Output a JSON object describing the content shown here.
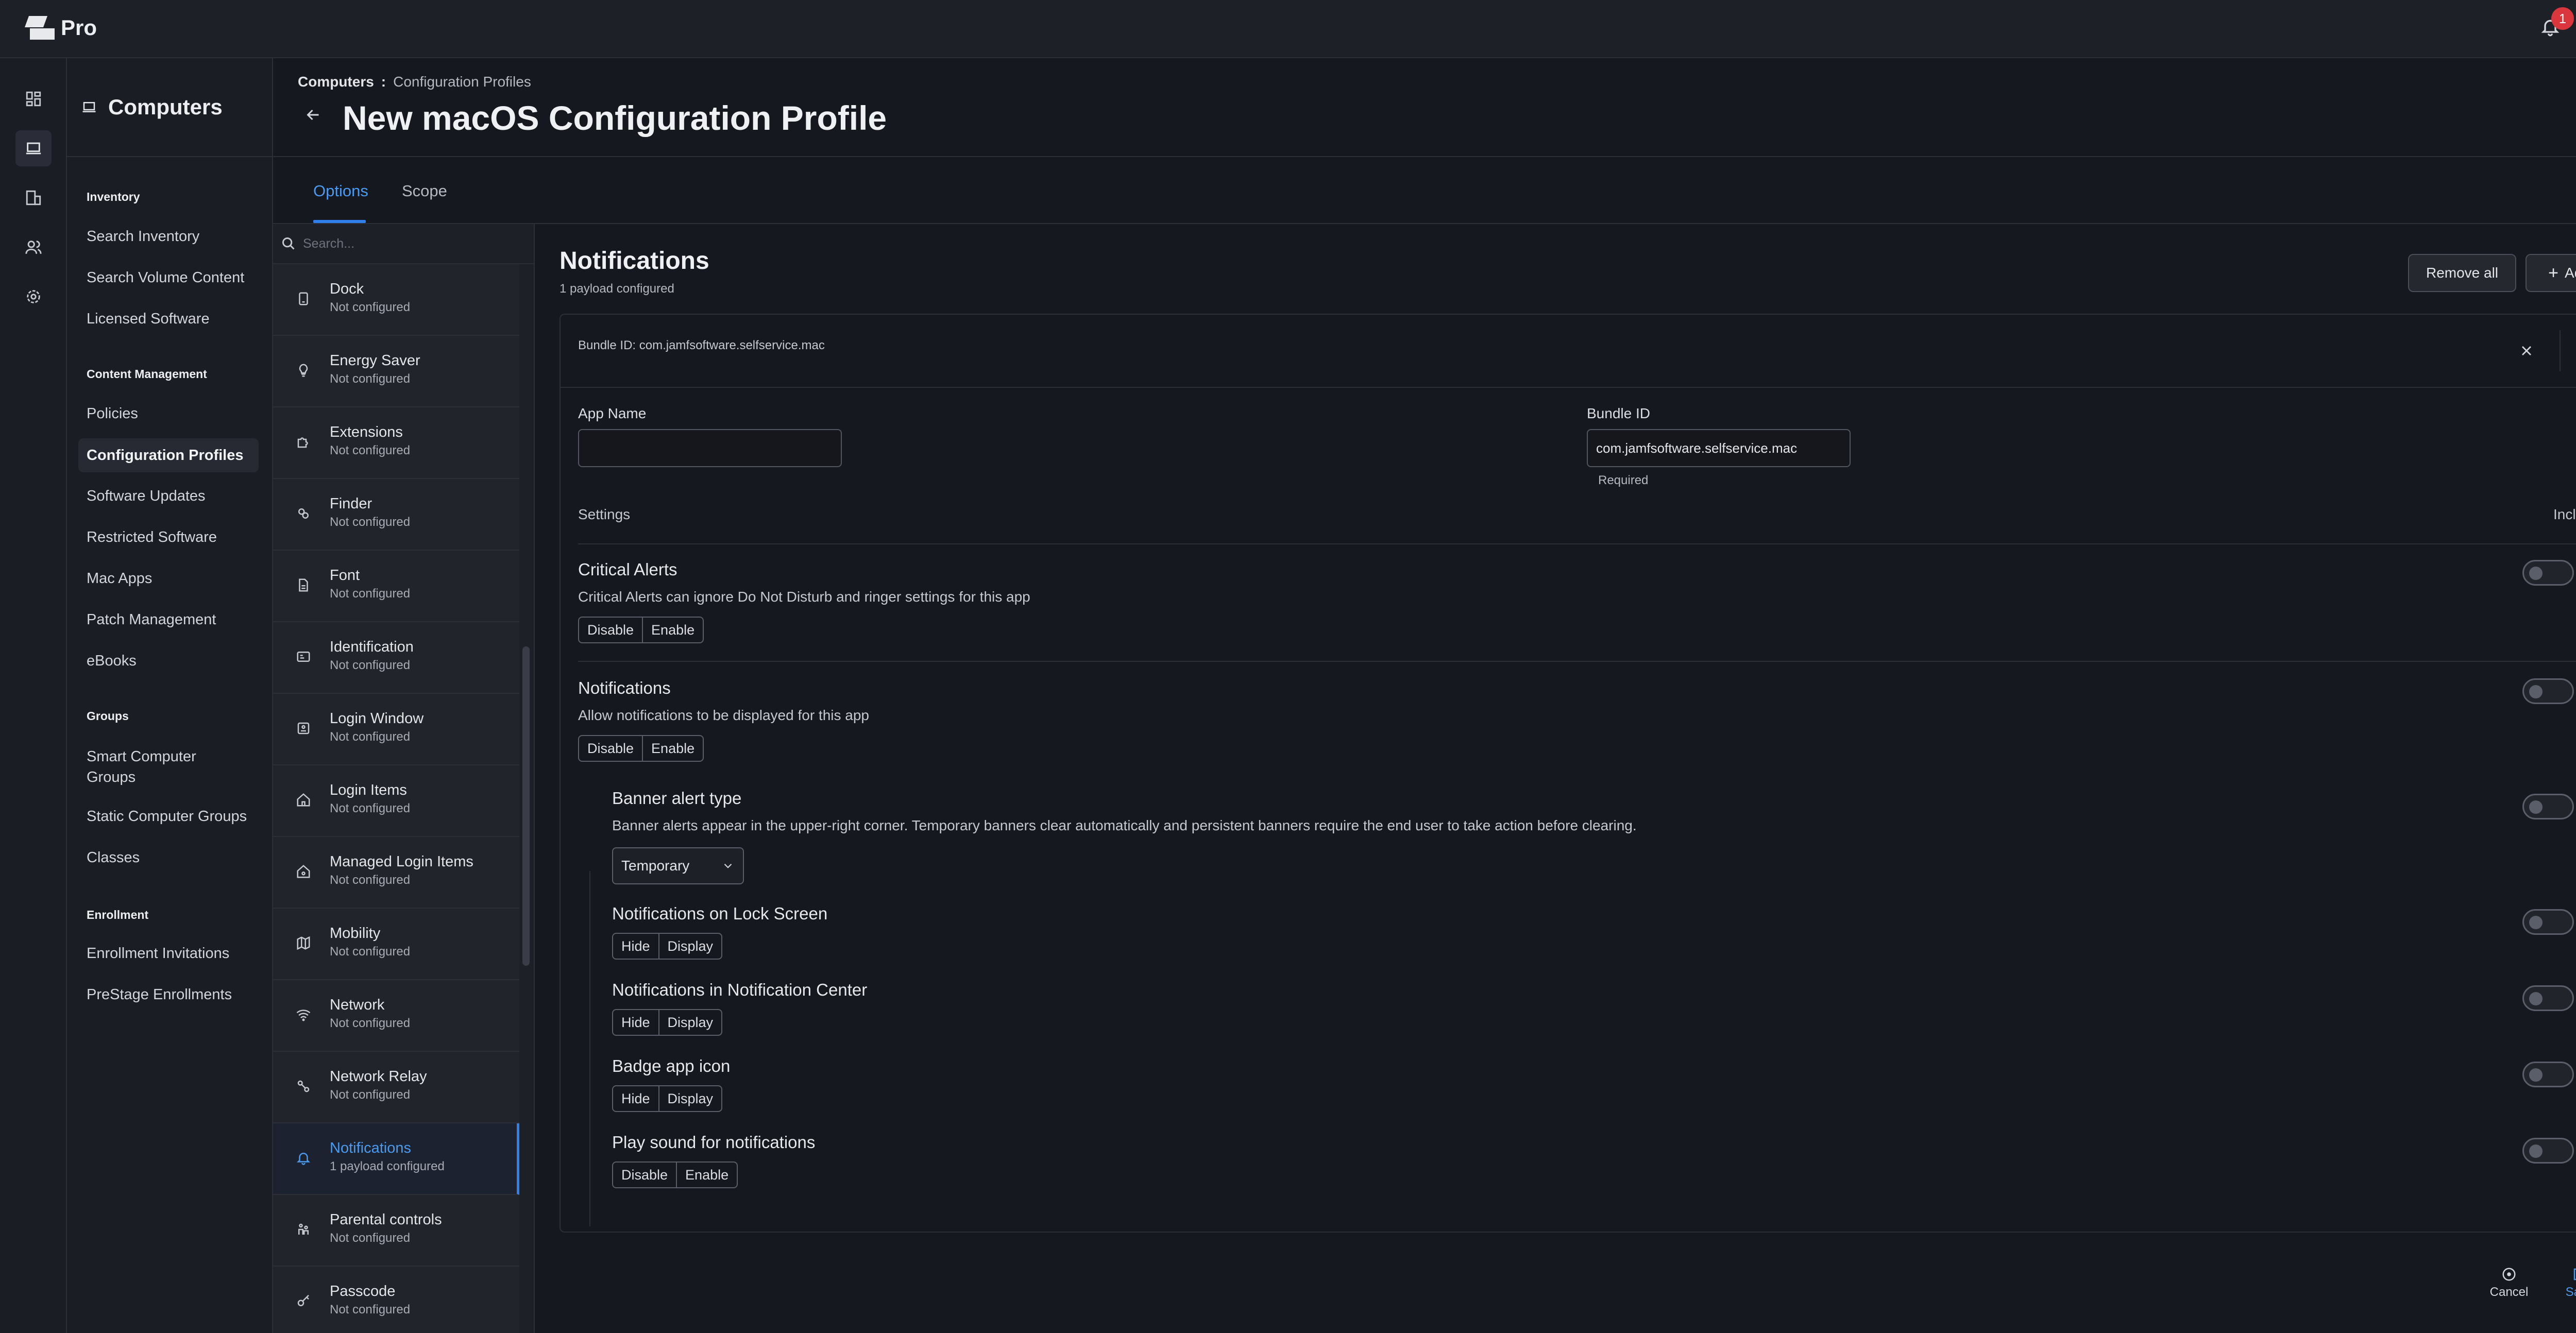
{
  "app": {
    "brand": "Pro",
    "notifications_count": "1"
  },
  "nav": {
    "title": "Computers",
    "sections": [
      {
        "heading": "Inventory",
        "items": [
          "Search Inventory",
          "Search Volume Content",
          "Licensed Software"
        ]
      },
      {
        "heading": "Content Management",
        "items": [
          "Policies",
          "Configuration Profiles",
          "Software Updates",
          "Restricted Software",
          "Mac Apps",
          "Patch Management",
          "eBooks"
        ]
      },
      {
        "heading": "Groups",
        "items": [
          "Smart Computer Groups",
          "Static Computer Groups",
          "Classes"
        ]
      },
      {
        "heading": "Enrollment",
        "items": [
          "Enrollment Invitations",
          "PreStage Enrollments"
        ]
      }
    ],
    "active_item": "Configuration Profiles"
  },
  "header": {
    "breadcrumb_root": "Computers",
    "breadcrumb_sep": ":",
    "breadcrumb_current": "Configuration Profiles",
    "title": "New macOS Configuration Profile"
  },
  "tabs": [
    {
      "label": "Options",
      "active": true
    },
    {
      "label": "Scope",
      "active": false
    }
  ],
  "payload_list": {
    "search_placeholder": "Search...",
    "items": [
      {
        "name": "Dock",
        "status": "Not configured",
        "icon": "dock-icon"
      },
      {
        "name": "Energy Saver",
        "status": "Not configured",
        "icon": "lightbulb-icon"
      },
      {
        "name": "Extensions",
        "status": "Not configured",
        "icon": "puzzle-icon"
      },
      {
        "name": "Finder",
        "status": "Not configured",
        "icon": "finder-icon"
      },
      {
        "name": "Font",
        "status": "Not configured",
        "icon": "file-icon"
      },
      {
        "name": "Identification",
        "status": "Not configured",
        "icon": "id-card-icon"
      },
      {
        "name": "Login Window",
        "status": "Not configured",
        "icon": "login-window-icon"
      },
      {
        "name": "Login Items",
        "status": "Not configured",
        "icon": "home-icon"
      },
      {
        "name": "Managed Login Items",
        "status": "Not configured",
        "icon": "home-gear-icon"
      },
      {
        "name": "Mobility",
        "status": "Not configured",
        "icon": "map-icon"
      },
      {
        "name": "Network",
        "status": "Not configured",
        "icon": "wifi-icon"
      },
      {
        "name": "Network Relay",
        "status": "Not configured",
        "icon": "relay-icon"
      },
      {
        "name": "Notifications",
        "status": "1 payload configured",
        "icon": "bell-icon",
        "active": true
      },
      {
        "name": "Parental controls",
        "status": "Not configured",
        "icon": "parental-icon"
      },
      {
        "name": "Passcode",
        "status": "Not configured",
        "icon": "key-icon"
      }
    ]
  },
  "content": {
    "title": "Notifications",
    "subtitle": "1 payload configured",
    "remove_all_label": "Remove all",
    "add_label": "Add",
    "bundle_header": "Bundle ID: com.jamfsoftware.selfservice.mac",
    "app_name_label": "App Name",
    "app_name_value": "",
    "bundle_id_label": "Bundle ID",
    "bundle_id_value": "com.jamfsoftware.selfservice.mac",
    "required_label": "Required",
    "settings_label": "Settings",
    "include_label": "Include",
    "settings": [
      {
        "title": "Critical Alerts",
        "desc": "Critical Alerts can ignore Do Not Disturb and ringer settings for this app",
        "options": [
          "Disable",
          "Enable"
        ]
      },
      {
        "title": "Notifications",
        "desc": "Allow notifications to be displayed for this app",
        "options": [
          "Disable",
          "Enable"
        ]
      }
    ],
    "sub_settings": [
      {
        "title": "Banner alert type",
        "desc": "Banner alerts appear in the upper-right corner. Temporary banners clear automatically and persistent banners require the end user to take action before clearing.",
        "select_value": "Temporary"
      },
      {
        "title": "Notifications on Lock Screen",
        "options": [
          "Hide",
          "Display"
        ]
      },
      {
        "title": "Notifications in Notification Center",
        "options": [
          "Hide",
          "Display"
        ]
      },
      {
        "title": "Badge app icon",
        "options": [
          "Hide",
          "Display"
        ]
      },
      {
        "title": "Play sound for notifications",
        "options": [
          "Disable",
          "Enable"
        ]
      }
    ],
    "cancel_label": "Cancel",
    "save_label": "Save"
  },
  "colors": {
    "accent": "#2f80ed",
    "badge": "#d9363e",
    "background": "#16181f"
  }
}
